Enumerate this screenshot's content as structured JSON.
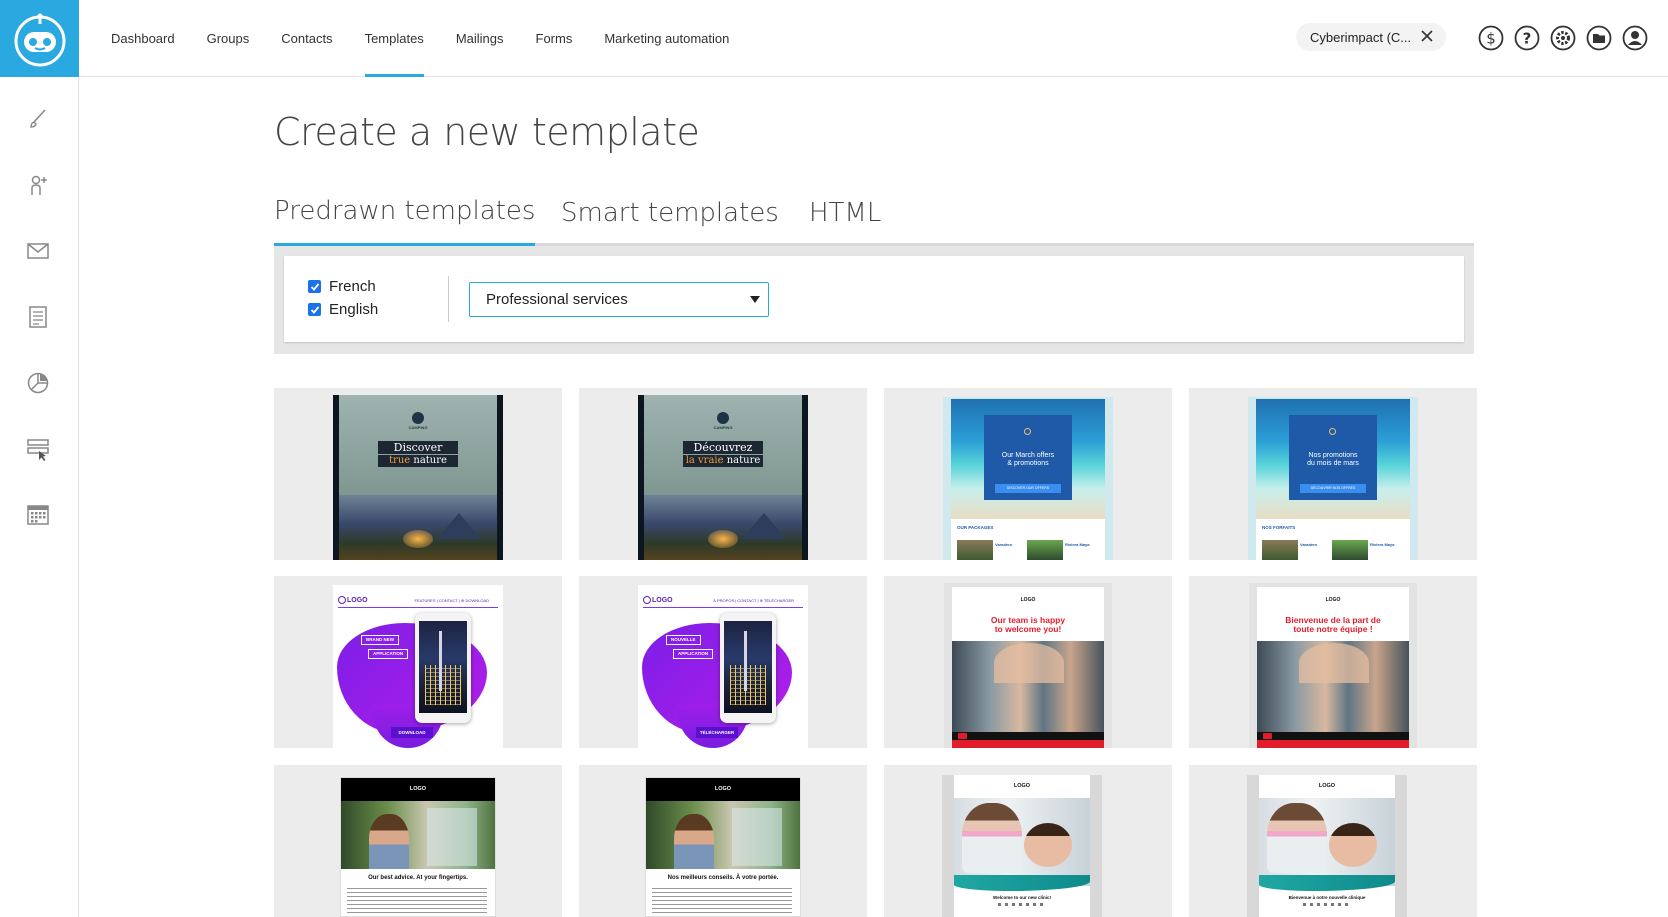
{
  "app": {
    "brand_color": "#29a9e0"
  },
  "nav": {
    "items": [
      {
        "label": "Dashboard"
      },
      {
        "label": "Groups"
      },
      {
        "label": "Contacts"
      },
      {
        "label": "Templates",
        "active": true
      },
      {
        "label": "Mailings"
      },
      {
        "label": "Forms"
      },
      {
        "label": "Marketing automation"
      }
    ]
  },
  "account": {
    "name": "Cyberimpact (C..."
  },
  "top_icons": [
    "dollar-icon",
    "help-icon",
    "settings-icon",
    "folder-icon",
    "user-icon"
  ],
  "sidebar_icons": [
    "brush-icon",
    "add-contact-icon",
    "mail-icon",
    "form-icon",
    "report-icon",
    "automation-icon",
    "calendar-icon"
  ],
  "page": {
    "title": "Create a new template"
  },
  "tabs": [
    {
      "label": "Predrawn templates",
      "active": true
    },
    {
      "label": "Smart templates"
    },
    {
      "label": "HTML"
    }
  ],
  "filters": {
    "languages": [
      {
        "label": "French",
        "checked": true
      },
      {
        "label": "English",
        "checked": true
      }
    ],
    "category": "Professional services"
  },
  "templates": [
    {
      "kind": "camping",
      "logo": "CAMPING",
      "line1": "Discover",
      "line2a": "true",
      "line2b": "nature"
    },
    {
      "kind": "camping",
      "logo": "CAMPING",
      "line1": "Découvrez",
      "line2a": "la vraie",
      "line2b": "nature"
    },
    {
      "kind": "travel",
      "headline1": "Our March offers",
      "headline2": "& promotions",
      "button": "DISCOVER OUR OFFERS",
      "section": "OUR PACKAGES",
      "item1": "Varadero",
      "item2": "Riviera Maya"
    },
    {
      "kind": "travel",
      "headline1": "Nos promotions",
      "headline2": "du mois de mars",
      "button": "DÉCOUVRIR NOS OFFRES",
      "section": "NOS FORFAITS",
      "item1": "Varadero",
      "item2": "Riviera Maya"
    },
    {
      "kind": "app",
      "logo": "LOGO",
      "menu": "FEATURES | CONTACT | ⊕ DOWNLOAD",
      "tag1": "BRAND NEW",
      "tag2": "APPLICATION",
      "cta": "DOWNLOAD"
    },
    {
      "kind": "app",
      "logo": "LOGO",
      "menu": "À PROPOS | CONTACT | ⊕ TÉLÉCHARGER",
      "tag1": "NOUVELLE",
      "tag2": "APPLICATION",
      "cta": "TÉLÉCHARGER"
    },
    {
      "kind": "gym",
      "logo": "LOGO",
      "headline1": "Our team is happy",
      "headline2": "to welcome you!"
    },
    {
      "kind": "gym",
      "logo": "LOGO",
      "headline1": "Bienvenue de la part de",
      "headline2": "toute notre équipe !"
    },
    {
      "kind": "advice",
      "logo": "LOGO",
      "headline": "Our best advice. At your fingertips."
    },
    {
      "kind": "advice",
      "logo": "LOGO",
      "headline": "Nos meilleurs conseils. À votre portée."
    },
    {
      "kind": "dental",
      "logo": "LOGO",
      "caption": "Welcome to our new clinic!"
    },
    {
      "kind": "dental",
      "logo": "LOGO",
      "caption": "Bienvenue à notre nouvelle clinique"
    }
  ]
}
